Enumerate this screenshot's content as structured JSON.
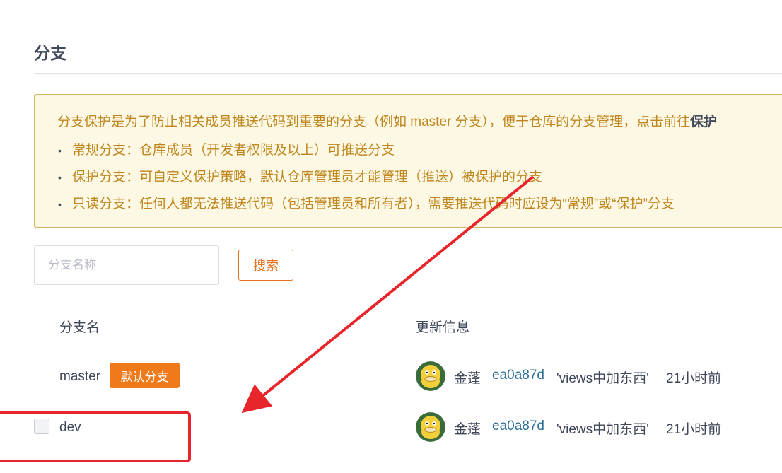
{
  "page": {
    "title": "分支"
  },
  "notice": {
    "intro": "分支保护是为了防止相关成员推送代码到重要的分支（例如 master 分支），便于仓库的分支管理，点击前往",
    "intro_link": "保护",
    "items": [
      "常规分支：仓库成员（开发者权限及以上）可推送分支",
      "保护分支：可自定义保护策略，默认仓库管理员才能管理（推送）被保护的分支",
      "只读分支：任何人都无法推送代码（包括管理员和所有者），需要推送代码时应设为“常规”或“保护”分支"
    ]
  },
  "search": {
    "placeholder": "分支名称",
    "button_label": "搜索"
  },
  "table": {
    "headers": {
      "name": "分支名",
      "info": "更新信息"
    },
    "rows": [
      {
        "name": "master",
        "badge": "默认分支",
        "author": "金蓬",
        "commit": "ea0a87d",
        "message": "'views中加东西'",
        "time": "21小时前"
      },
      {
        "name": "dev",
        "author": "金蓬",
        "commit": "ea0a87d",
        "message": "'views中加东西'",
        "time": "21小时前"
      }
    ]
  },
  "colors": {
    "accent": "#e3701c",
    "annotation": "#e8252a",
    "notice_bg": "#fcf8e3",
    "notice_text": "#c0861e",
    "commit_link": "#2d6f96"
  }
}
